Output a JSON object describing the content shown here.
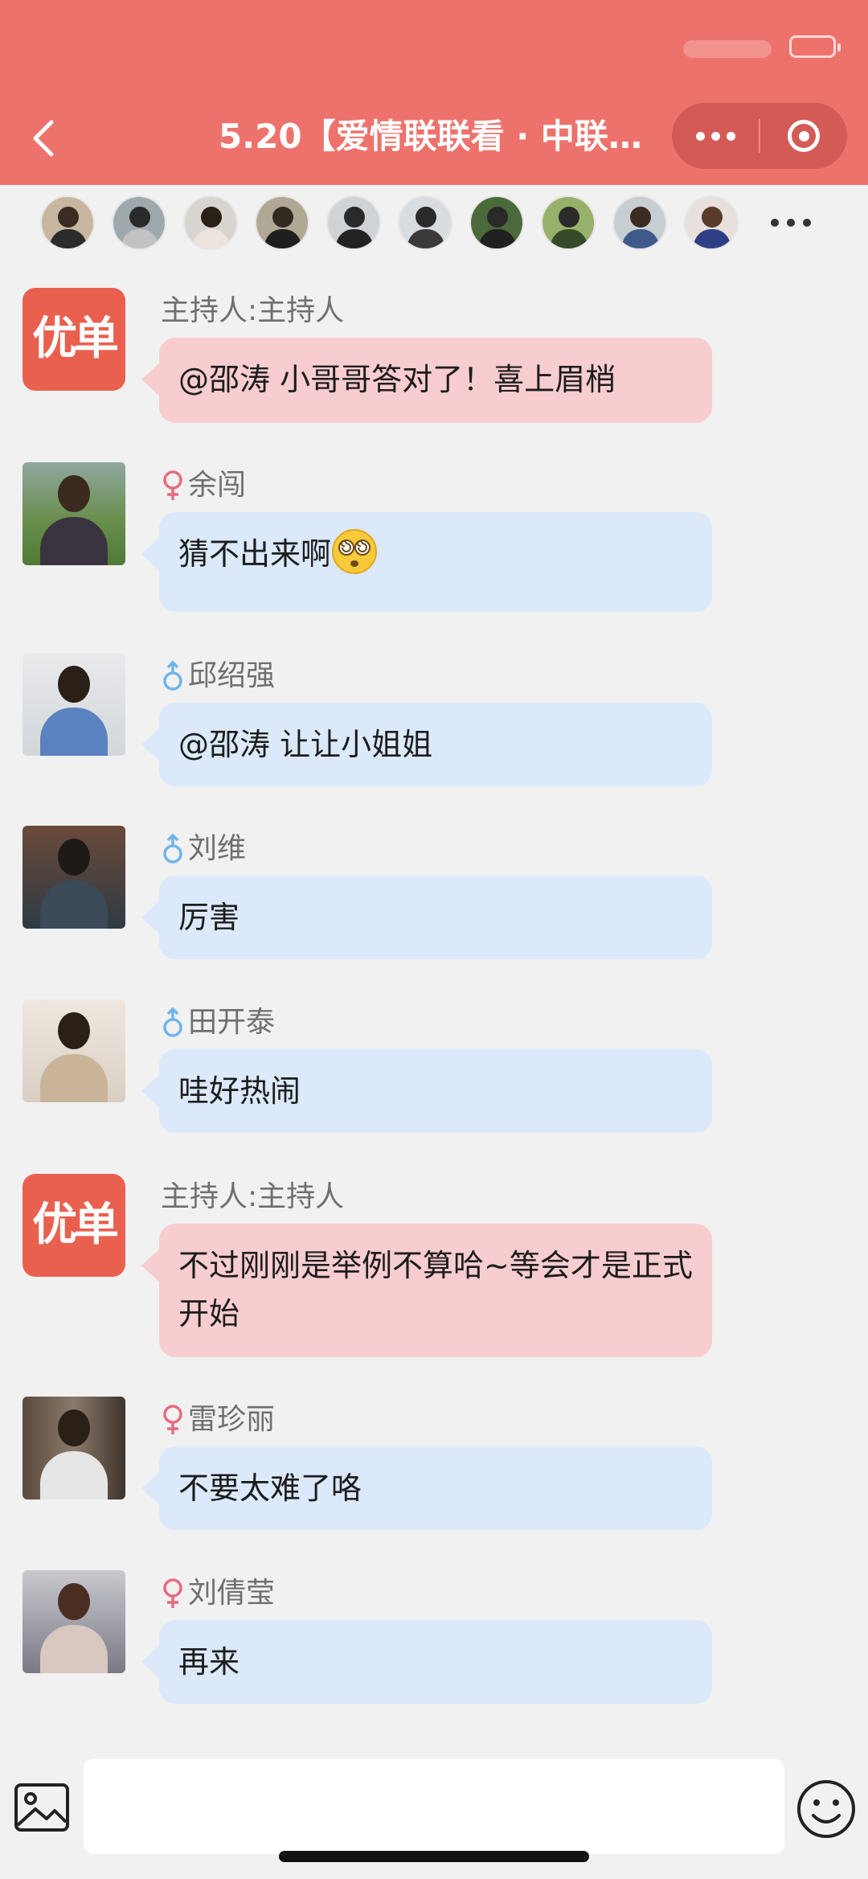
{
  "header": {
    "title": "5.20【爱情联联看 · 中联…",
    "bg_color": "#ee726c"
  },
  "participants": [
    {
      "bg": "#c9b6a0",
      "head": "#3a2c22",
      "body": "#2b2b2b"
    },
    {
      "bg": "#9fa8ad",
      "head": "#2a2a2a",
      "body": "#c2c2c2"
    },
    {
      "bg": "#d8d5d0",
      "head": "#2a2018",
      "body": "#ece4dc"
    },
    {
      "bg": "#b0a895",
      "head": "#332a22",
      "body": "#1f1f1f"
    },
    {
      "bg": "#d0d3d6",
      "head": "#2a2a2a",
      "body": "#222222"
    },
    {
      "bg": "#d9dde2",
      "head": "#2a2a2a",
      "body": "#3a3a3a"
    },
    {
      "bg": "#4b6a3a",
      "head": "#2a2a2a",
      "body": "#202020"
    },
    {
      "bg": "#98b16a",
      "head": "#2a2a2a",
      "body": "#364a2a"
    },
    {
      "bg": "#c8cdd2",
      "head": "#3a2c22",
      "body": "#3e5a8a"
    },
    {
      "bg": "#e8e0dc",
      "head": "#5a3a2a",
      "body": "#2f3f86"
    }
  ],
  "messages": [
    {
      "sender": "主持人:主持人",
      "text": "@邵涛 小哥哥答对了！喜上眉梢",
      "role": "host",
      "logo": "优单"
    },
    {
      "sender": "余闯",
      "text": "猜不出来啊",
      "role": "user",
      "gender": "female",
      "emoji": "dizzy-face-emoji"
    },
    {
      "sender": "邱绍强",
      "text": "@邵涛 让让小姐姐",
      "role": "user",
      "gender": "male"
    },
    {
      "sender": "刘维",
      "text": "厉害",
      "role": "user",
      "gender": "male"
    },
    {
      "sender": "田开泰",
      "text": "哇好热闹",
      "role": "user",
      "gender": "male"
    },
    {
      "sender": "主持人:主持人",
      "text": "不过刚刚是举例不算哈~等会才是正式开始",
      "role": "host",
      "logo": "优单"
    },
    {
      "sender": "雷珍丽",
      "text": "不要太难了咯",
      "role": "user",
      "gender": "female"
    },
    {
      "sender": "刘倩莹",
      "text": "再来",
      "role": "user",
      "gender": "female"
    }
  ],
  "colors": {
    "host_bubble": "#f7cdd0",
    "user_bubble": "#dbe9fb",
    "female_icon": "#e96a7f",
    "male_icon": "#6fb5ea"
  },
  "input": {
    "placeholder": ""
  }
}
